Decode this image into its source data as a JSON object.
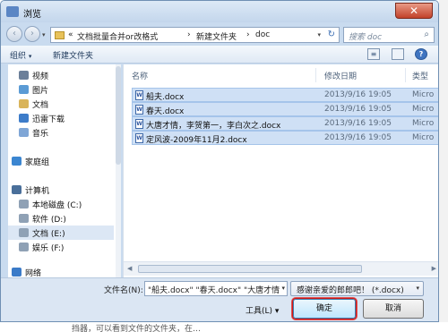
{
  "window": {
    "title": "浏览",
    "close_label": "✕"
  },
  "background_text": {
    "bottom": "挡器，可以看到文件的文件夹，在…"
  },
  "nav": {
    "back": "‹",
    "forward": "›",
    "history_caret": "▾"
  },
  "address": {
    "breadcrumbs": [
      "«",
      "文档批量合并or改格式",
      "新建文件夹",
      "doc"
    ],
    "separator": "›",
    "dropdown": "▾",
    "refresh": "↻"
  },
  "search": {
    "placeholder": "搜索 doc",
    "icon": "search-icon"
  },
  "toolbar": {
    "organize_label": "组织",
    "organize_caret": "▾",
    "new_folder_label": "新建文件夹",
    "view_icon": "≡",
    "help_icon": "?"
  },
  "sidebar": {
    "items": [
      {
        "label": "视频",
        "icon": "video-icon",
        "color": "#6b7f99"
      },
      {
        "label": "图片",
        "icon": "pictures-icon",
        "color": "#5b9bd5"
      },
      {
        "label": "文档",
        "icon": "documents-icon",
        "color": "#d9b45a"
      },
      {
        "label": "迅雷下载",
        "icon": "download-icon",
        "color": "#3d7cc9"
      },
      {
        "label": "音乐",
        "icon": "music-icon",
        "color": "#7fa6d6"
      },
      {
        "label": "家庭组",
        "icon": "homegroup-icon",
        "color": "#3b86d1"
      },
      {
        "label": "计算机",
        "icon": "computer-icon",
        "color": "#4a6f9a"
      },
      {
        "label": "本地磁盘 (C:)",
        "icon": "drive-icon",
        "color": "#8fa1b5"
      },
      {
        "label": "软件 (D:)",
        "icon": "drive-icon",
        "color": "#8fa1b5"
      },
      {
        "label": "文档 (E:)",
        "icon": "drive-icon",
        "color": "#8fa1b5",
        "selected": true
      },
      {
        "label": "娱乐 (F:)",
        "icon": "drive-icon",
        "color": "#8fa1b5"
      },
      {
        "label": "网络",
        "icon": "network-icon",
        "color": "#3b7bc8"
      }
    ]
  },
  "file_list": {
    "columns": [
      "名称",
      "修改日期",
      "类型"
    ],
    "rows": [
      {
        "name": "船夫.docx",
        "modified": "2013/9/16 19:05",
        "type": "Micro"
      },
      {
        "name": "春天.docx",
        "modified": "2013/9/16 19:05",
        "type": "Micro"
      },
      {
        "name": "大唐才情，李贺第一，李白次之.docx",
        "modified": "2013/9/16 19:05",
        "type": "Micro"
      },
      {
        "name": "定风波-2009年11月2.docx",
        "modified": "2013/9/16 19:05",
        "type": "Micro"
      }
    ],
    "file_icon_letter": "W"
  },
  "footer": {
    "filename_label": "文件名(N):",
    "filename_value": "\"船夫.docx\" \"春天.docx\" \"大唐才情",
    "filter_value": "感谢亲爱的郎郎吧！ (*.docx)",
    "tools_label": "工具(L)",
    "tools_caret": "▾",
    "open_label": "确定",
    "cancel_label": "取消"
  },
  "colors": {
    "accent": "#3c7fb1",
    "highlight_border": "#cc1a1a",
    "selection": "#cfe0f5"
  }
}
